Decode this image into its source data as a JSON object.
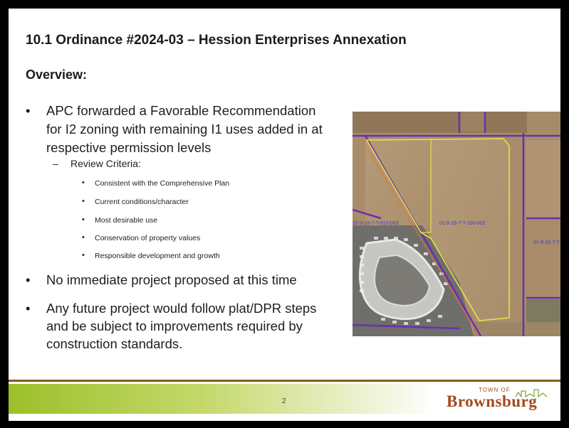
{
  "slide": {
    "title": "10.1 Ordinance #2024-03 – Hession Enterprises Annexation",
    "overview_heading": "Overview:",
    "bullet_char": "•",
    "dash_char": "–",
    "bullets": [
      {
        "lines": [
          "APC forwarded a Favorable Recommendation",
          "for I2 zoning with remaining I1 uses added in at",
          "respective permission levels"
        ]
      },
      {
        "lines": [
          "No immediate project proposed at this time"
        ]
      },
      {
        "lines": [
          "Any future project would follow plat/DPR steps",
          "and be subject to improvements required by",
          "construction standards."
        ]
      }
    ],
    "review": {
      "label": "Review Criteria:",
      "items": [
        "Consistent with the Comprehensive Plan",
        "Current conditions/character",
        "Most desirable use",
        "Conservation of property values",
        "Responsible development and growth"
      ]
    },
    "map": {
      "parcel_labels": [
        "32-9-16-?-?-010-003",
        "01-9-16-?-?-100-002",
        "01-9-16-?-?"
      ]
    },
    "footer": {
      "page_number": "2",
      "logo_small": "TOWN OF",
      "logo_big": "Brownsburg"
    },
    "colors": {
      "parcel_outline": "#e6e24a",
      "boundary": "#6a2fb0",
      "footer_accent": "#9cc02a",
      "logo": "#a34a1c"
    }
  }
}
